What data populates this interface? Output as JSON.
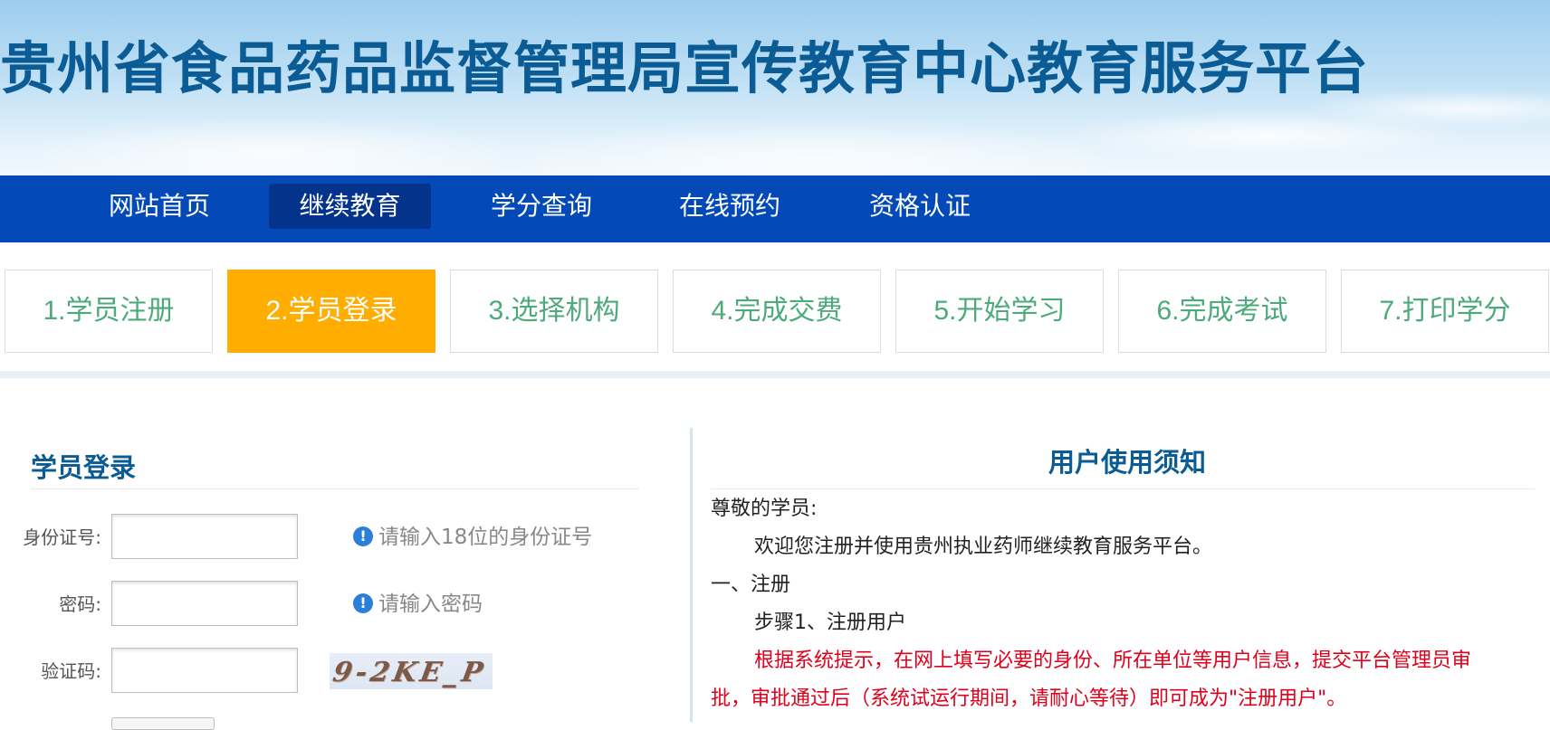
{
  "header": {
    "site_title": "贵州省食品药品监督管理局宣传教育中心教育服务平台"
  },
  "nav": {
    "items": [
      {
        "label": "网站首页",
        "active": false
      },
      {
        "label": "继续教育",
        "active": true
      },
      {
        "label": "学分查询",
        "active": false
      },
      {
        "label": "在线预约",
        "active": false
      },
      {
        "label": "资格认证",
        "active": false
      }
    ]
  },
  "steps": [
    {
      "label": "1.学员注册",
      "active": false
    },
    {
      "label": "2.学员登录",
      "active": true
    },
    {
      "label": "3.选择机构",
      "active": false
    },
    {
      "label": "4.完成交费",
      "active": false
    },
    {
      "label": "5.开始学习",
      "active": false
    },
    {
      "label": "6.完成考试",
      "active": false
    },
    {
      "label": "7.打印学分",
      "active": false
    }
  ],
  "login": {
    "title": "学员登录",
    "id_label": "身份证号:",
    "id_value": "",
    "id_hint": "请输入18位的身份证号",
    "password_label": "密码:",
    "password_value": "",
    "password_hint": "请输入密码",
    "captcha_label": "验证码:",
    "captcha_value": "",
    "captcha_image_text": "9-2KE_P"
  },
  "notice": {
    "title": "用户使用须知",
    "greeting": "尊敬的学员:",
    "welcome": "欢迎您注册并使用贵州执业药师继续教育服务平台。",
    "section1": "一、注册",
    "step1": "步骤1、注册用户",
    "desc_line1": "根据系统提示，在网上填写必要的身份、所在单位等用户信息，提交平台管理员审",
    "desc_line2": "批，审批通过后（系统试运行期间，请耐心等待）即可成为\"注册用户\"。"
  },
  "colors": {
    "title_blue": "#0b5c94",
    "nav_blue": "#0449b8",
    "nav_active": "#04338c",
    "step_active": "#ffad00",
    "step_text": "#4daa7a",
    "notice_red": "#e0001b"
  }
}
